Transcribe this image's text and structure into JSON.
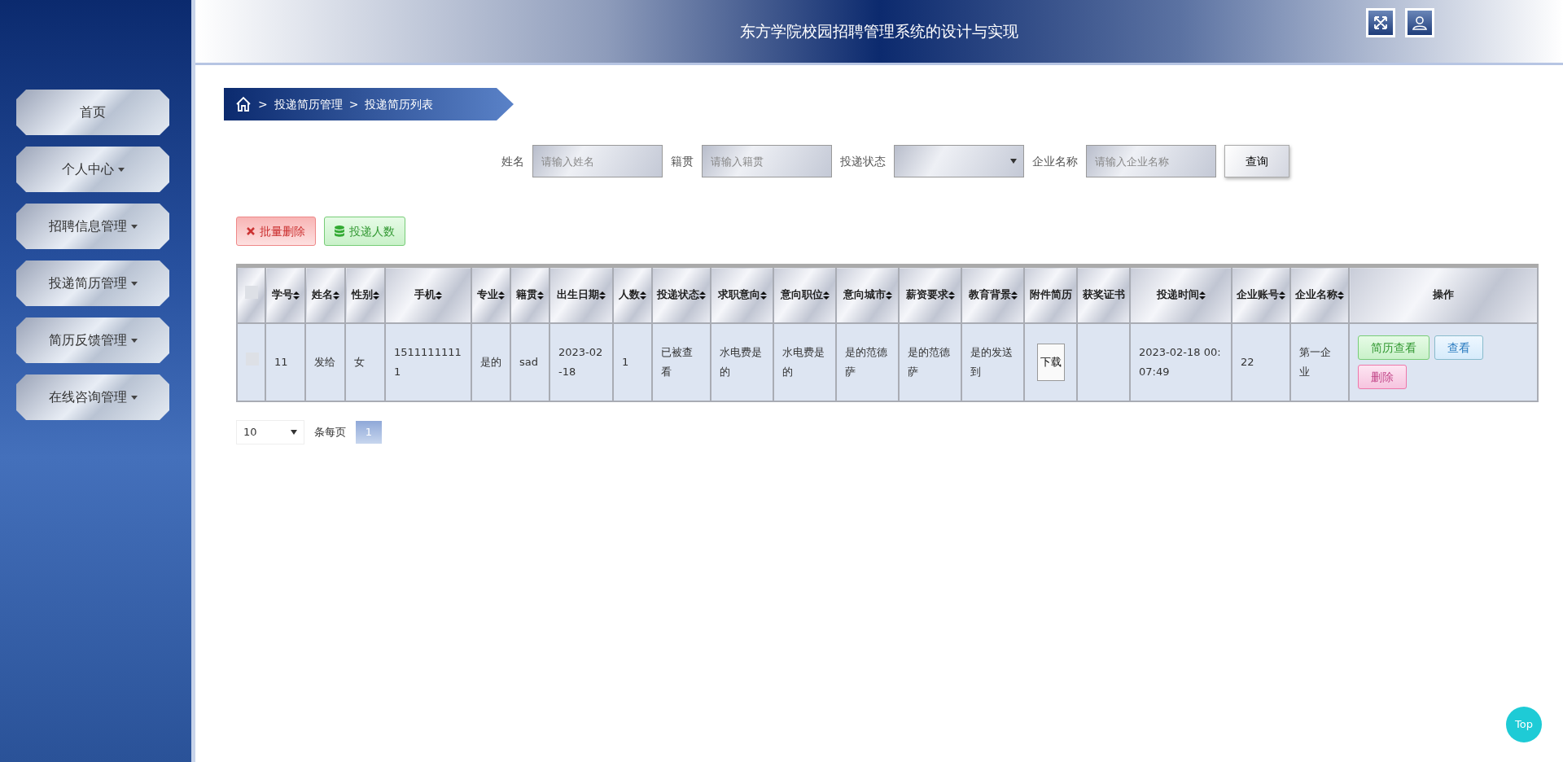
{
  "header": {
    "title": "东方学院校园招聘管理系统的设计与实现"
  },
  "sidebar": {
    "items": [
      {
        "label": "首页",
        "dropdown": false
      },
      {
        "label": "个人中心",
        "dropdown": true
      },
      {
        "label": "招聘信息管理",
        "dropdown": true
      },
      {
        "label": "投递简历管理",
        "dropdown": true
      },
      {
        "label": "简历反馈管理",
        "dropdown": true
      },
      {
        "label": "在线咨询管理",
        "dropdown": true
      }
    ]
  },
  "breadcrumb": [
    {
      "separator": ">",
      "label": "投递简历管理"
    },
    {
      "separator": ">",
      "label": "投递简历列表"
    }
  ],
  "search": {
    "fields": [
      {
        "label": "姓名",
        "kind": "text",
        "placeholder": "请输入姓名"
      },
      {
        "label": "籍贯",
        "kind": "text",
        "placeholder": "请输入籍贯"
      },
      {
        "label": "投递状态",
        "kind": "select"
      },
      {
        "label": "企业名称",
        "kind": "text",
        "placeholder": "请输入企业名称"
      }
    ],
    "button": "查询"
  },
  "actions": [
    {
      "label": "批量删除",
      "kind": "danger"
    },
    {
      "label": "投递人数",
      "kind": "success"
    }
  ],
  "table": {
    "select_all": {
      "checked": false
    },
    "columns": [
      {
        "label": "学号",
        "sortable": true
      },
      {
        "label": "姓名",
        "sortable": true
      },
      {
        "label": "性别",
        "sortable": true
      },
      {
        "label": "手机",
        "sortable": true
      },
      {
        "label": "专业",
        "sortable": true
      },
      {
        "label": "籍贯",
        "sortable": true
      },
      {
        "label": "出生日期",
        "sortable": true
      },
      {
        "label": "人数",
        "sortable": true
      },
      {
        "label": "投递状态",
        "sortable": true
      },
      {
        "label": "求职意向",
        "sortable": true
      },
      {
        "label": "意向职位",
        "sortable": true
      },
      {
        "label": "意向城市",
        "sortable": true
      },
      {
        "label": "薪资要求",
        "sortable": true
      },
      {
        "label": "教育背景",
        "sortable": true
      },
      {
        "label": "附件简历",
        "sortable": false
      },
      {
        "label": "获奖证书",
        "sortable": false
      },
      {
        "label": "投递时间",
        "sortable": true
      },
      {
        "label": "企业账号",
        "sortable": true
      },
      {
        "label": "企业名称",
        "sortable": true
      },
      {
        "label": "操作",
        "sortable": false
      }
    ],
    "rows": [
      {
        "checked": false,
        "cells": [
          "11",
          "发给",
          "女",
          "15111111111",
          "是的",
          "sad",
          "2023-02-18",
          "1",
          "已被查看",
          "水电费是的",
          "水电费是的",
          "是的范德萨",
          "是的范德萨",
          "是的发送到",
          "",
          "",
          "2023-02-18 00:07:49",
          "22",
          "第一企业"
        ],
        "download": "下载",
        "operations": [
          {
            "label": "简历查看",
            "kind": "success"
          },
          {
            "label": "查看",
            "kind": "info"
          },
          {
            "label": "删除",
            "kind": "danger"
          }
        ]
      }
    ]
  },
  "pagination": {
    "page_size": "10",
    "page_size_label": "条每页",
    "pages": [
      {
        "label": "1",
        "selected": true
      }
    ]
  },
  "top_button": "Top"
}
